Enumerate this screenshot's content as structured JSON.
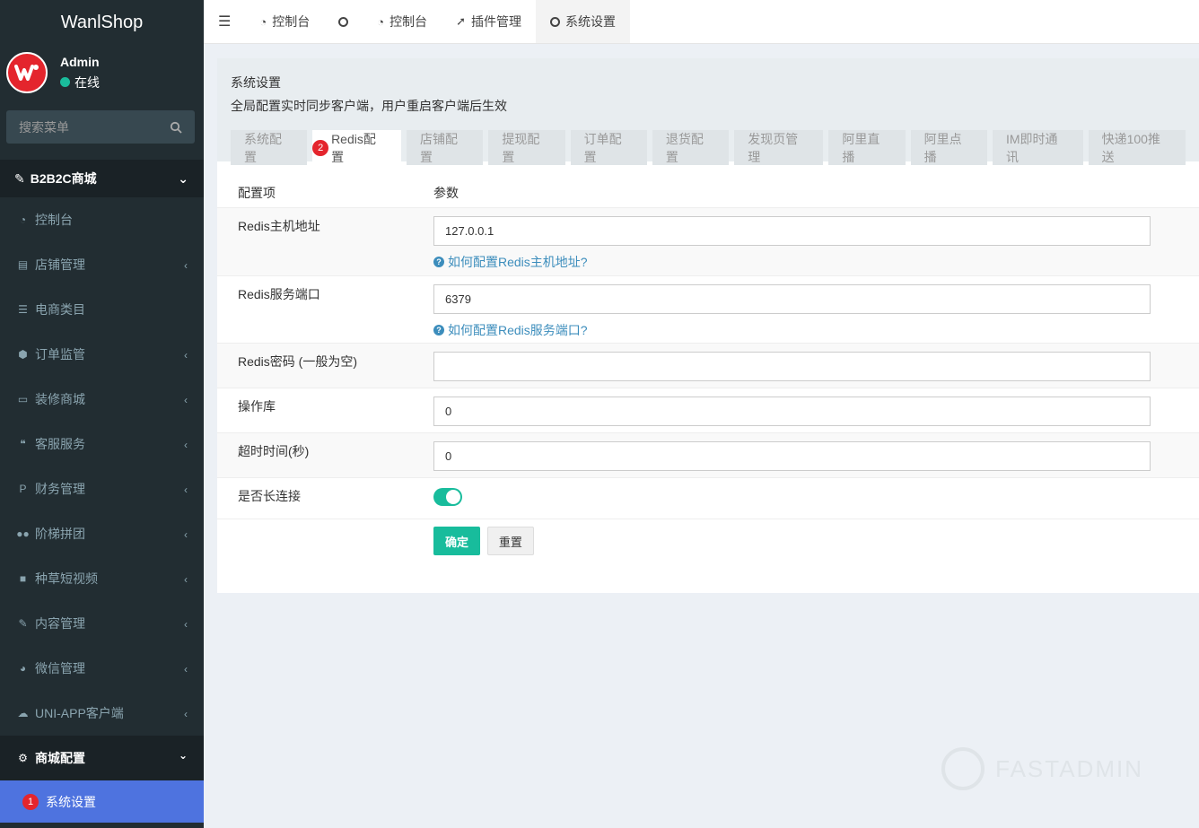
{
  "app": {
    "logo": "WanlShop"
  },
  "user": {
    "name": "Admin",
    "status": "在线"
  },
  "search": {
    "placeholder": "搜索菜单"
  },
  "sidebar": {
    "header": "B2B2C商城",
    "items": [
      {
        "label": "控制台",
        "icon": "dashboard-icon"
      },
      {
        "label": "店铺管理",
        "icon": "store-icon"
      },
      {
        "label": "电商类目",
        "icon": "list-icon"
      },
      {
        "label": "订单监管",
        "icon": "cube-icon"
      },
      {
        "label": "装修商城",
        "icon": "monitor-icon"
      },
      {
        "label": "客服服务",
        "icon": "comments-icon"
      },
      {
        "label": "财务管理",
        "icon": "paypal-icon"
      },
      {
        "label": "阶梯拼团",
        "icon": "users-icon"
      },
      {
        "label": "种草短视频",
        "icon": "video-icon"
      },
      {
        "label": "内容管理",
        "icon": "edit-icon"
      },
      {
        "label": "微信管理",
        "icon": "wechat-icon"
      },
      {
        "label": "UNI-APP客户端",
        "icon": "cloud-icon"
      }
    ],
    "section": "商城配置",
    "active": {
      "label": "系统设置",
      "badge": "1"
    }
  },
  "topbar": {
    "tabs": [
      {
        "label": "控制台"
      },
      {
        "label": ""
      },
      {
        "label": "控制台"
      },
      {
        "label": "插件管理"
      },
      {
        "label": "系统设置"
      }
    ]
  },
  "panel": {
    "title": "系统设置",
    "desc": "全局配置实时同步客户端，用户重启客户端后生效",
    "tabs": [
      "系统配置",
      "Redis配置",
      "店铺配置",
      "提现配置",
      "订单配置",
      "退货配置",
      "发现页管理",
      "阿里直播",
      "阿里点播",
      "IM即时通讯",
      "快递100推送"
    ],
    "active_tab_badge": "2"
  },
  "table": {
    "col1_header": "配置项",
    "col2_header": "参数",
    "rows": [
      {
        "label": "Redis主机地址",
        "value": "127.0.0.1",
        "help": "如何配置Redis主机地址?"
      },
      {
        "label": "Redis服务端口",
        "value": "6379",
        "help": "如何配置Redis服务端口?"
      },
      {
        "label": "Redis密码 (一般为空)",
        "value": ""
      },
      {
        "label": "操作库",
        "value": "0"
      },
      {
        "label": "超时时间(秒)",
        "value": "0"
      },
      {
        "label": "是否长连接",
        "toggle": "on"
      }
    ],
    "ok_label": "确定",
    "reset_label": "重置"
  },
  "watermark": "FASTADMIN",
  "colors": {
    "sidebar": "#222d32",
    "active": "#4e73df",
    "accent": "#18bc9c",
    "link": "#3c8dbc"
  }
}
